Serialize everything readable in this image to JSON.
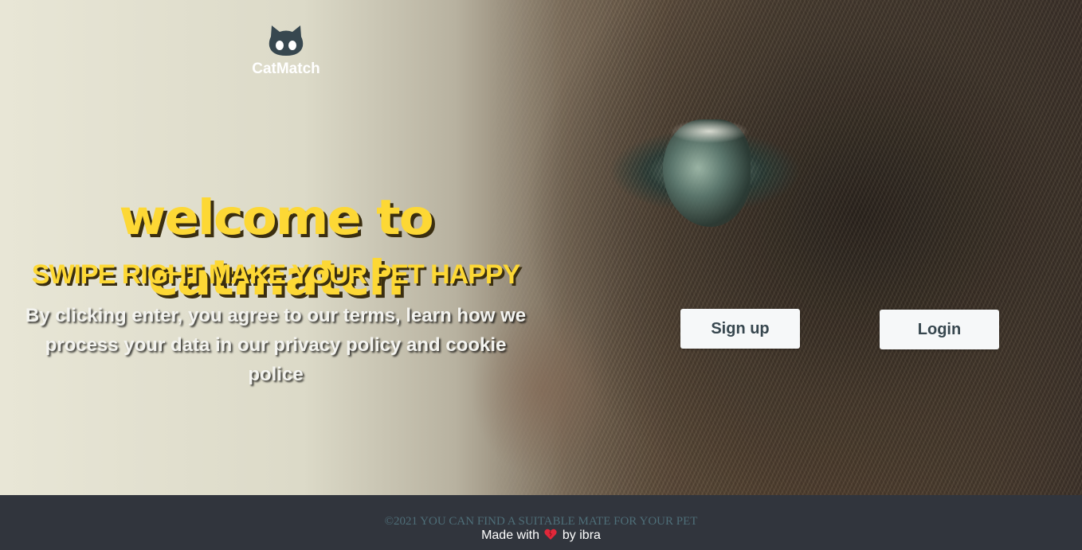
{
  "brand": {
    "name": "CatMatch",
    "logo_icon": "github-cat-icon"
  },
  "hero": {
    "title": "welcome to catmatch",
    "tagline": "SWIPE RIGHT MAKE YOUR PET HAPPY",
    "terms_text": "By clicking enter, you agree to our terms, learn how we process your data in our privacy policy and cookie police",
    "title_color": "#fdd835"
  },
  "actions": {
    "signup_label": "Sign up",
    "login_label": "Login"
  },
  "footer": {
    "copyright": "©2021 YOU CAN FIND A SUITABLE MATE FOR YOUR PET",
    "made_with_prefix": "Made with",
    "heart_icon": "heart-icon",
    "made_with_suffix": "by ibra",
    "background": "#31353d"
  }
}
